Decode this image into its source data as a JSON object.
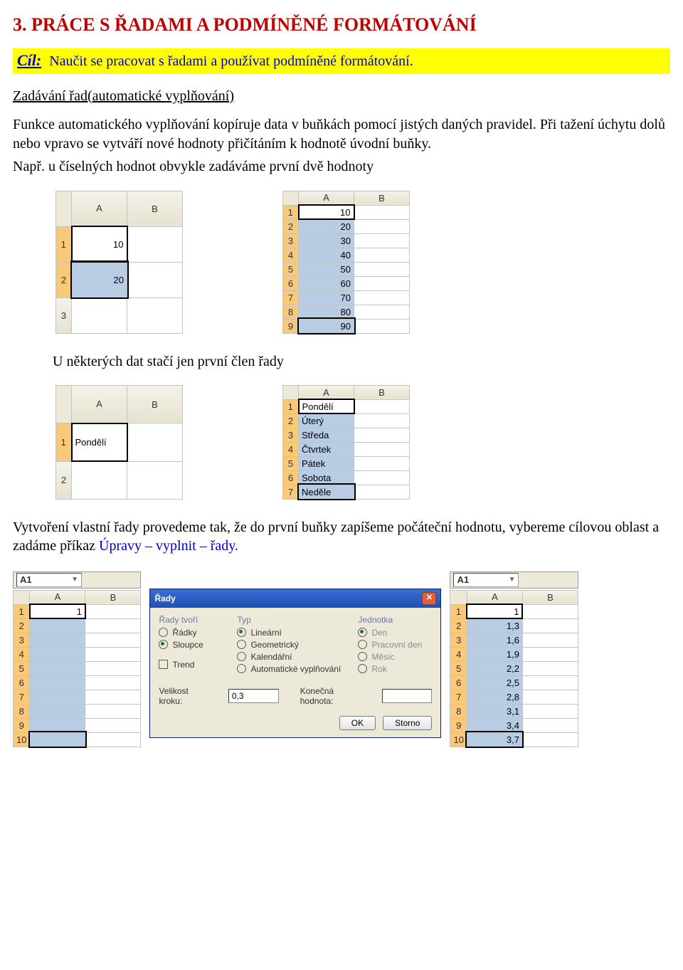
{
  "title": "3.  PRÁCE S ŘADAMI A PODMÍNĚNÉ FORMÁTOVÁNÍ",
  "goal_label": "Cíl:",
  "goal_text": "Naučit se pracovat s řadami a používat podmíněné formátování.",
  "subhead1": "Zadávání řad(automatické vyplňování)",
  "para1": "Funkce automatického vyplňování kopíruje data v buňkách pomocí jistých daných pravidel. Při tažení úchytu dolů nebo vpravo se vytváří nové hodnoty přičítáním k hodnotě úvodní buňky.",
  "para2": "Např. u číselných hodnot obvykle zadáváme první dvě hodnoty",
  "para3": "U některých dat stačí jen první člen řady",
  "para4a": "Vytvoření vlastní řady provedeme tak, že do první buňky zapíšeme počáteční hodnotu, vybereme cílovou oblast a zadáme příkaz  ",
  "para4b": "Úpravy – vyplnit – řady.",
  "sheetA": {
    "colA": "A",
    "colB": "B",
    "rows": [
      "1",
      "2",
      "3"
    ],
    "vals": [
      "10",
      "20"
    ]
  },
  "sheetB": {
    "colA": "A",
    "colB": "B",
    "rows": [
      "1",
      "2",
      "3",
      "4",
      "5",
      "6",
      "7",
      "8",
      "9"
    ],
    "vals": [
      "10",
      "20",
      "30",
      "40",
      "50",
      "60",
      "70",
      "80",
      "90"
    ]
  },
  "sheetC": {
    "colA": "A",
    "colB": "B",
    "rows": [
      "1",
      "2"
    ],
    "val": "Pondělí"
  },
  "sheetD": {
    "colA": "A",
    "colB": "B",
    "rows": [
      "1",
      "2",
      "3",
      "4",
      "5",
      "6",
      "7"
    ],
    "vals": [
      "Pondělí",
      "Úterý",
      "Středa",
      "Čtvrtek",
      "Pátek",
      "Sobota",
      "Neděle"
    ]
  },
  "namebox": "A1",
  "sheetE": {
    "colA": "A",
    "colB": "B",
    "rows": [
      "1",
      "2",
      "3",
      "4",
      "5",
      "6",
      "7",
      "8",
      "9",
      "10"
    ],
    "val": "1"
  },
  "sheetF": {
    "colA": "A",
    "colB": "B",
    "rows": [
      "1",
      "2",
      "3",
      "4",
      "5",
      "6",
      "7",
      "8",
      "9",
      "10"
    ],
    "vals": [
      "1",
      "1,3",
      "1,6",
      "1,9",
      "2,2",
      "2,5",
      "2,8",
      "3,1",
      "3,4",
      "3,7"
    ]
  },
  "dialog": {
    "title": "Řady",
    "group1": {
      "title": "Řady tvoří",
      "opt1": "Řádky",
      "opt2": "Sloupce"
    },
    "group2": {
      "title": "Typ",
      "opt1": "Lineární",
      "opt2": "Geometrický",
      "opt3": "Kalendářní",
      "opt4": "Automatické vyplňování"
    },
    "group3": {
      "title": "Jednotka",
      "opt1": "Den",
      "opt2": "Pracovní den",
      "opt3": "Měsíc",
      "opt4": "Rok"
    },
    "trend": "Trend",
    "step_label": "Velikost kroku:",
    "step_value": "0,3",
    "end_label": "Konečná hodnota:",
    "ok": "OK",
    "cancel": "Storno"
  }
}
